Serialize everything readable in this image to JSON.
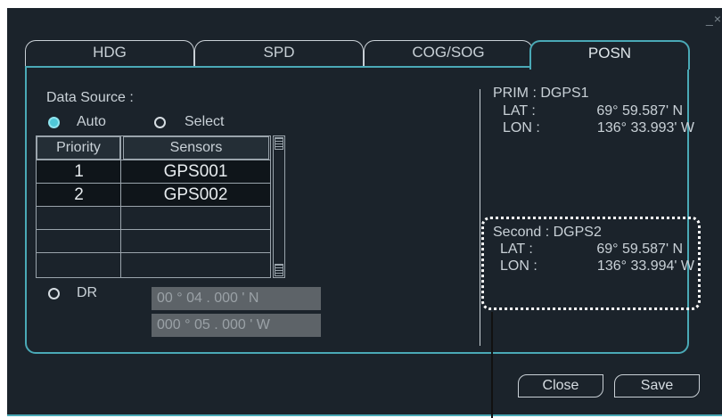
{
  "window": {
    "close_glyph": "_×"
  },
  "tabs": [
    {
      "label": "HDG",
      "active": false
    },
    {
      "label": "SPD",
      "active": false
    },
    {
      "label": "COG/SOG",
      "active": false
    },
    {
      "label": "POSN",
      "active": true
    }
  ],
  "data_source": {
    "label": "Data Source :",
    "auto_label": "Auto",
    "select_label": "Select",
    "selected": "Auto"
  },
  "sensor_table": {
    "headers": [
      "Priority",
      "Sensors"
    ],
    "rows": [
      {
        "priority": "1",
        "sensor": "GPS001"
      },
      {
        "priority": "2",
        "sensor": "GPS002"
      }
    ],
    "empty_rows": 3
  },
  "dr": {
    "label": "DR",
    "lat_value": "00 ° 04 . 000 ' N",
    "lon_value": "000 ° 05 . 000 ' W"
  },
  "prim": {
    "title": "PRIM : DGPS1",
    "lat_label": "LAT :",
    "lat_value": "69° 59.587' N",
    "lon_label": "LON :",
    "lon_value": "136° 33.993' W"
  },
  "second": {
    "title": "Second : DGPS2",
    "lat_label": "LAT :",
    "lat_value": "69° 59.587' N",
    "lon_label": "LON :",
    "lon_value": "136° 33.994' W"
  },
  "buttons": {
    "close_label": "Close",
    "save_label": "Save"
  },
  "colors": {
    "accent": "#4aa9b6",
    "background": "#1b232b",
    "radio_on": "#4fc7d8"
  }
}
